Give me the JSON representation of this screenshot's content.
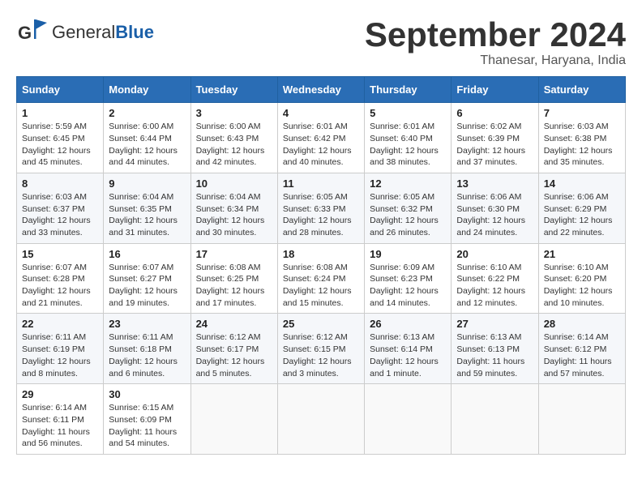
{
  "header": {
    "logo_text_general": "General",
    "logo_text_blue": "Blue",
    "month_year": "September 2024",
    "location": "Thanesar, Haryana, India"
  },
  "days_of_week": [
    "Sunday",
    "Monday",
    "Tuesday",
    "Wednesday",
    "Thursday",
    "Friday",
    "Saturday"
  ],
  "weeks": [
    [
      {
        "num": "1",
        "sunrise": "5:59 AM",
        "sunset": "6:45 PM",
        "daylight": "12 hours and 45 minutes."
      },
      {
        "num": "2",
        "sunrise": "6:00 AM",
        "sunset": "6:44 PM",
        "daylight": "12 hours and 44 minutes."
      },
      {
        "num": "3",
        "sunrise": "6:00 AM",
        "sunset": "6:43 PM",
        "daylight": "12 hours and 42 minutes."
      },
      {
        "num": "4",
        "sunrise": "6:01 AM",
        "sunset": "6:42 PM",
        "daylight": "12 hours and 40 minutes."
      },
      {
        "num": "5",
        "sunrise": "6:01 AM",
        "sunset": "6:40 PM",
        "daylight": "12 hours and 38 minutes."
      },
      {
        "num": "6",
        "sunrise": "6:02 AM",
        "sunset": "6:39 PM",
        "daylight": "12 hours and 37 minutes."
      },
      {
        "num": "7",
        "sunrise": "6:03 AM",
        "sunset": "6:38 PM",
        "daylight": "12 hours and 35 minutes."
      }
    ],
    [
      {
        "num": "8",
        "sunrise": "6:03 AM",
        "sunset": "6:37 PM",
        "daylight": "12 hours and 33 minutes."
      },
      {
        "num": "9",
        "sunrise": "6:04 AM",
        "sunset": "6:35 PM",
        "daylight": "12 hours and 31 minutes."
      },
      {
        "num": "10",
        "sunrise": "6:04 AM",
        "sunset": "6:34 PM",
        "daylight": "12 hours and 30 minutes."
      },
      {
        "num": "11",
        "sunrise": "6:05 AM",
        "sunset": "6:33 PM",
        "daylight": "12 hours and 28 minutes."
      },
      {
        "num": "12",
        "sunrise": "6:05 AM",
        "sunset": "6:32 PM",
        "daylight": "12 hours and 26 minutes."
      },
      {
        "num": "13",
        "sunrise": "6:06 AM",
        "sunset": "6:30 PM",
        "daylight": "12 hours and 24 minutes."
      },
      {
        "num": "14",
        "sunrise": "6:06 AM",
        "sunset": "6:29 PM",
        "daylight": "12 hours and 22 minutes."
      }
    ],
    [
      {
        "num": "15",
        "sunrise": "6:07 AM",
        "sunset": "6:28 PM",
        "daylight": "12 hours and 21 minutes."
      },
      {
        "num": "16",
        "sunrise": "6:07 AM",
        "sunset": "6:27 PM",
        "daylight": "12 hours and 19 minutes."
      },
      {
        "num": "17",
        "sunrise": "6:08 AM",
        "sunset": "6:25 PM",
        "daylight": "12 hours and 17 minutes."
      },
      {
        "num": "18",
        "sunrise": "6:08 AM",
        "sunset": "6:24 PM",
        "daylight": "12 hours and 15 minutes."
      },
      {
        "num": "19",
        "sunrise": "6:09 AM",
        "sunset": "6:23 PM",
        "daylight": "12 hours and 14 minutes."
      },
      {
        "num": "20",
        "sunrise": "6:10 AM",
        "sunset": "6:22 PM",
        "daylight": "12 hours and 12 minutes."
      },
      {
        "num": "21",
        "sunrise": "6:10 AM",
        "sunset": "6:20 PM",
        "daylight": "12 hours and 10 minutes."
      }
    ],
    [
      {
        "num": "22",
        "sunrise": "6:11 AM",
        "sunset": "6:19 PM",
        "daylight": "12 hours and 8 minutes."
      },
      {
        "num": "23",
        "sunrise": "6:11 AM",
        "sunset": "6:18 PM",
        "daylight": "12 hours and 6 minutes."
      },
      {
        "num": "24",
        "sunrise": "6:12 AM",
        "sunset": "6:17 PM",
        "daylight": "12 hours and 5 minutes."
      },
      {
        "num": "25",
        "sunrise": "6:12 AM",
        "sunset": "6:15 PM",
        "daylight": "12 hours and 3 minutes."
      },
      {
        "num": "26",
        "sunrise": "6:13 AM",
        "sunset": "6:14 PM",
        "daylight": "12 hours and 1 minute."
      },
      {
        "num": "27",
        "sunrise": "6:13 AM",
        "sunset": "6:13 PM",
        "daylight": "11 hours and 59 minutes."
      },
      {
        "num": "28",
        "sunrise": "6:14 AM",
        "sunset": "6:12 PM",
        "daylight": "11 hours and 57 minutes."
      }
    ],
    [
      {
        "num": "29",
        "sunrise": "6:14 AM",
        "sunset": "6:11 PM",
        "daylight": "11 hours and 56 minutes."
      },
      {
        "num": "30",
        "sunrise": "6:15 AM",
        "sunset": "6:09 PM",
        "daylight": "11 hours and 54 minutes."
      },
      null,
      null,
      null,
      null,
      null
    ]
  ],
  "labels": {
    "sunrise": "Sunrise: ",
    "sunset": "Sunset: ",
    "daylight": "Daylight: "
  }
}
